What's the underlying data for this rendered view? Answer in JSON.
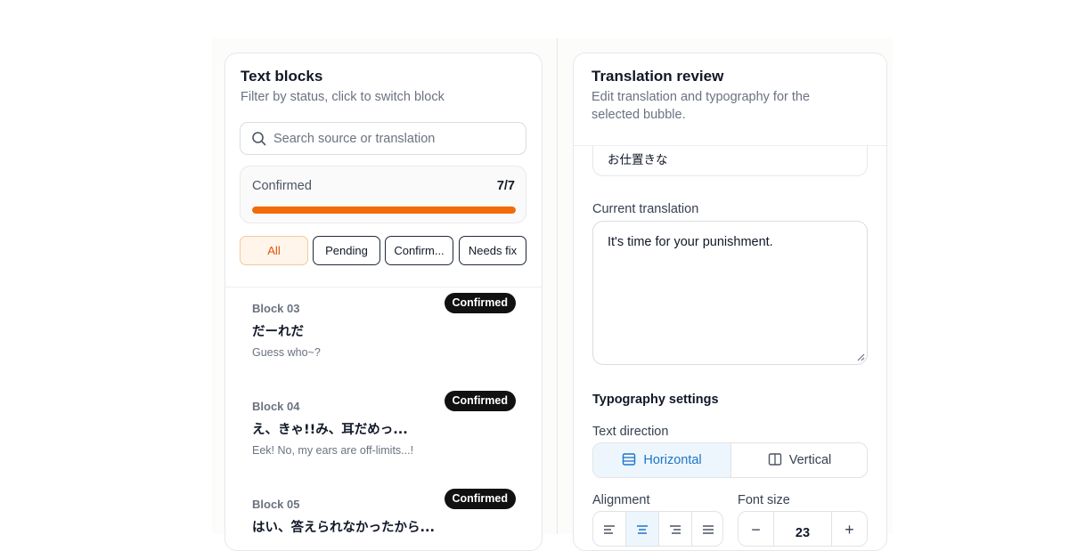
{
  "left_panel": {
    "title": "Text blocks",
    "subtitle": "Filter by status, click to switch block",
    "search": {
      "placeholder": "Search source or translation",
      "value": ""
    },
    "progress": {
      "label": "Confirmed",
      "count": "7/7",
      "fraction": 1.0
    },
    "filters": [
      {
        "label": "All",
        "active": true
      },
      {
        "label": "Pending",
        "active": false
      },
      {
        "label": "Confirm...",
        "active": false
      },
      {
        "label": "Needs fix",
        "active": false
      }
    ],
    "items": [
      {
        "block": "Block 03",
        "status": "Confirmed",
        "source": "だーれだ",
        "translation": "Guess who~?"
      },
      {
        "block": "Block 04",
        "status": "Confirmed",
        "source": "え、きゃ!!み、耳だめっ...",
        "translation": "Eek! No, my ears are off-limits...!"
      },
      {
        "block": "Block 05",
        "status": "Confirmed",
        "source": "はい、答えられなかったから...",
        "translation": ""
      }
    ]
  },
  "right_panel": {
    "title": "Translation review",
    "subtitle_line1": "Edit translation and typography for the",
    "subtitle_line2": "selected bubble.",
    "source_text_partial": "お仕置きな",
    "current_translation_label": "Current translation",
    "current_translation": "It's time for your punishment.",
    "typography_title": "Typography settings",
    "text_direction_label": "Text direction",
    "direction_options": [
      {
        "label": "Horizontal",
        "icon": "horizontal-text-icon",
        "active": true
      },
      {
        "label": "Vertical",
        "icon": "vertical-text-icon",
        "active": false
      }
    ],
    "alignment_label": "Alignment",
    "alignment_options": [
      "align-left-icon",
      "align-center-icon",
      "align-right-icon",
      "align-justify-icon"
    ],
    "alignment_selected": "align-center-icon",
    "font_size_label": "Font size",
    "font_size": "23"
  },
  "colors": {
    "accent_orange": "#f26a0a",
    "accent_blue": "#1c76c9",
    "badge_dark": "#111111"
  }
}
